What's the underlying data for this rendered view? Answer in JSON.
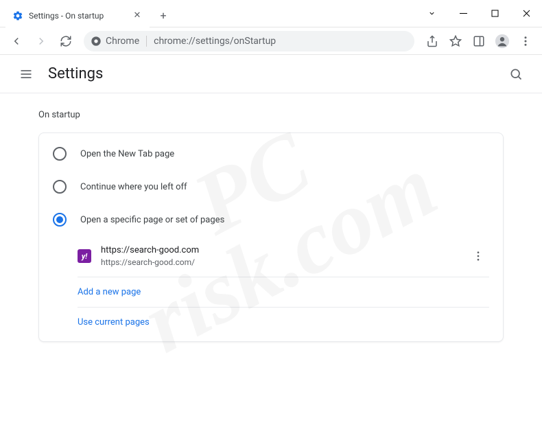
{
  "window": {
    "tab_title": "Settings - On startup",
    "chrome_chip": "Chrome",
    "url": "chrome://settings/onStartup"
  },
  "header": {
    "title": "Settings"
  },
  "section": {
    "title": "On startup",
    "options": [
      {
        "label": "Open the New Tab page",
        "selected": false
      },
      {
        "label": "Continue where you left off",
        "selected": false
      },
      {
        "label": "Open a specific page or set of pages",
        "selected": true
      }
    ],
    "pages": [
      {
        "title": "https://search-good.com",
        "url": "https://search-good.com/",
        "favicon_letter": "y!"
      }
    ],
    "add_page_label": "Add a new page",
    "use_current_label": "Use current pages"
  },
  "watermark": {
    "line1": "PC",
    "line2": "risk.com"
  }
}
